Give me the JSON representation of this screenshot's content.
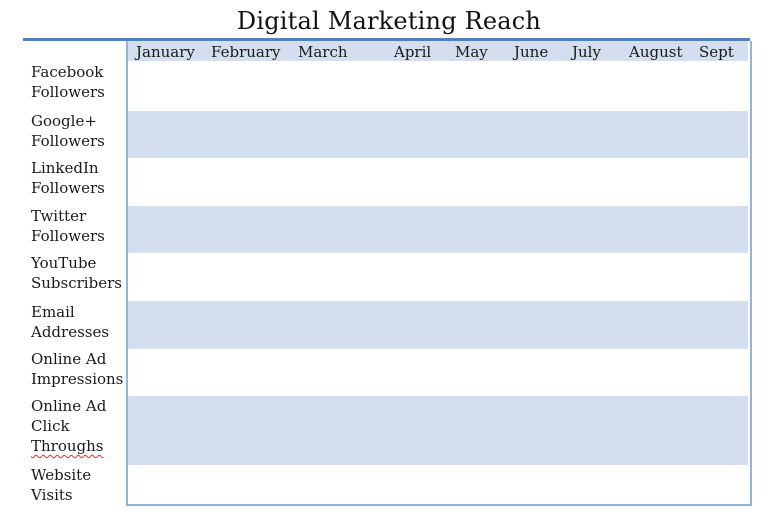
{
  "document": {
    "title": "Digital Marketing Reach",
    "accent_color": "#4f81bd",
    "band_color": "#d3dfee",
    "border_color": "#95b3d7"
  },
  "table": {
    "columns": [
      "January",
      "February",
      "March",
      "April",
      "May",
      "June",
      "July",
      "August",
      "Sept"
    ],
    "rows": [
      {
        "lines": [
          "Facebook",
          "Followers"
        ],
        "values": [
          "",
          "",
          "",
          "",
          "",
          "",
          "",
          "",
          ""
        ]
      },
      {
        "lines": [
          "Google+",
          "Followers"
        ],
        "values": [
          "",
          "",
          "",
          "",
          "",
          "",
          "",
          "",
          ""
        ]
      },
      {
        "lines": [
          "LinkedIn",
          "Followers"
        ],
        "values": [
          "",
          "",
          "",
          "",
          "",
          "",
          "",
          "",
          ""
        ]
      },
      {
        "lines": [
          "Twitter",
          "Followers"
        ],
        "values": [
          "",
          "",
          "",
          "",
          "",
          "",
          "",
          "",
          ""
        ]
      },
      {
        "lines": [
          "YouTube",
          "Subscribers"
        ],
        "values": [
          "",
          "",
          "",
          "",
          "",
          "",
          "",
          "",
          ""
        ]
      },
      {
        "lines": [
          "Email",
          "Addresses"
        ],
        "values": [
          "",
          "",
          "",
          "",
          "",
          "",
          "",
          "",
          ""
        ]
      },
      {
        "lines": [
          "Online Ad",
          "Impressions"
        ],
        "values": [
          "",
          "",
          "",
          "",
          "",
          "",
          "",
          "",
          ""
        ]
      },
      {
        "lines": [
          "Online Ad",
          "Click",
          "Throughs"
        ],
        "values": [
          "",
          "",
          "",
          "",
          "",
          "",
          "",
          "",
          ""
        ]
      },
      {
        "lines": [
          "Website",
          "Visits"
        ],
        "values": [
          "",
          "",
          "",
          "",
          "",
          "",
          "",
          "",
          ""
        ]
      }
    ]
  }
}
